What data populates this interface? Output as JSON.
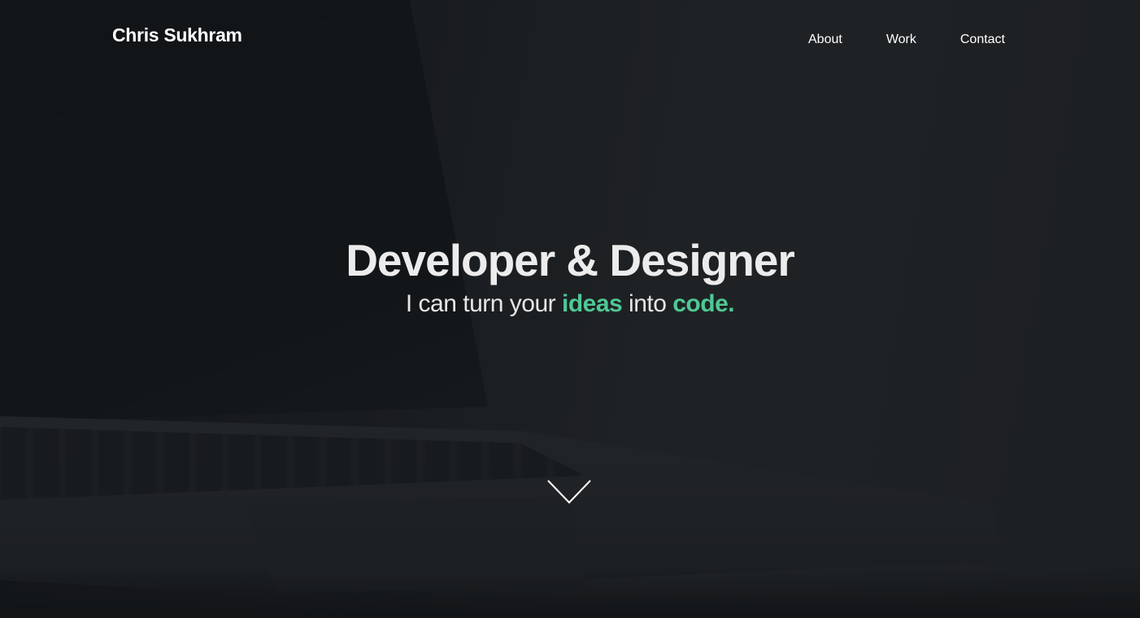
{
  "header": {
    "brand": "Chris Sukhram",
    "nav": [
      {
        "label": "About"
      },
      {
        "label": "Work"
      },
      {
        "label": "Contact"
      }
    ]
  },
  "hero": {
    "headline": "Developer & Designer",
    "tagline": {
      "part1": "I can turn your ",
      "accent1": "ideas",
      "part2": " into ",
      "accent2": "code."
    },
    "scroll_icon": "chevron-down-icon"
  },
  "colors": {
    "accent": "#4fc894",
    "text": "#ffffff",
    "background": "#1e2125"
  }
}
